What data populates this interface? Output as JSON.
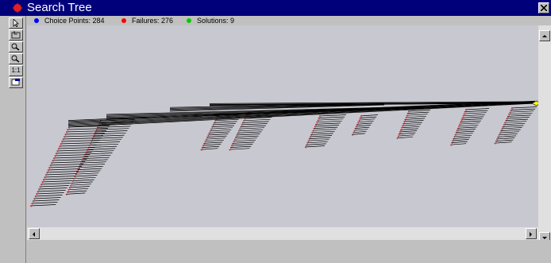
{
  "window": {
    "title": "Search Tree"
  },
  "legend": {
    "choice_points": "Choice Points: 284",
    "failures": "Failures: 276",
    "solutions": "Solutions: 9",
    "colors": {
      "choice": "#0000ff",
      "failure": "#ff0000",
      "solution": "#00cc00"
    }
  },
  "toolbar": {
    "zoom_reset_label": "1:1",
    "icons": [
      "select-arrow-icon",
      "fit-to-window-icon",
      "zoom-in-icon",
      "zoom-out-icon",
      "zoom-actual-icon",
      "tree-layout-icon"
    ]
  },
  "tree": {
    "edge_color": "#000000",
    "failure_color": "#ff0000",
    "solution_marker_color": "#ffff00"
  }
}
